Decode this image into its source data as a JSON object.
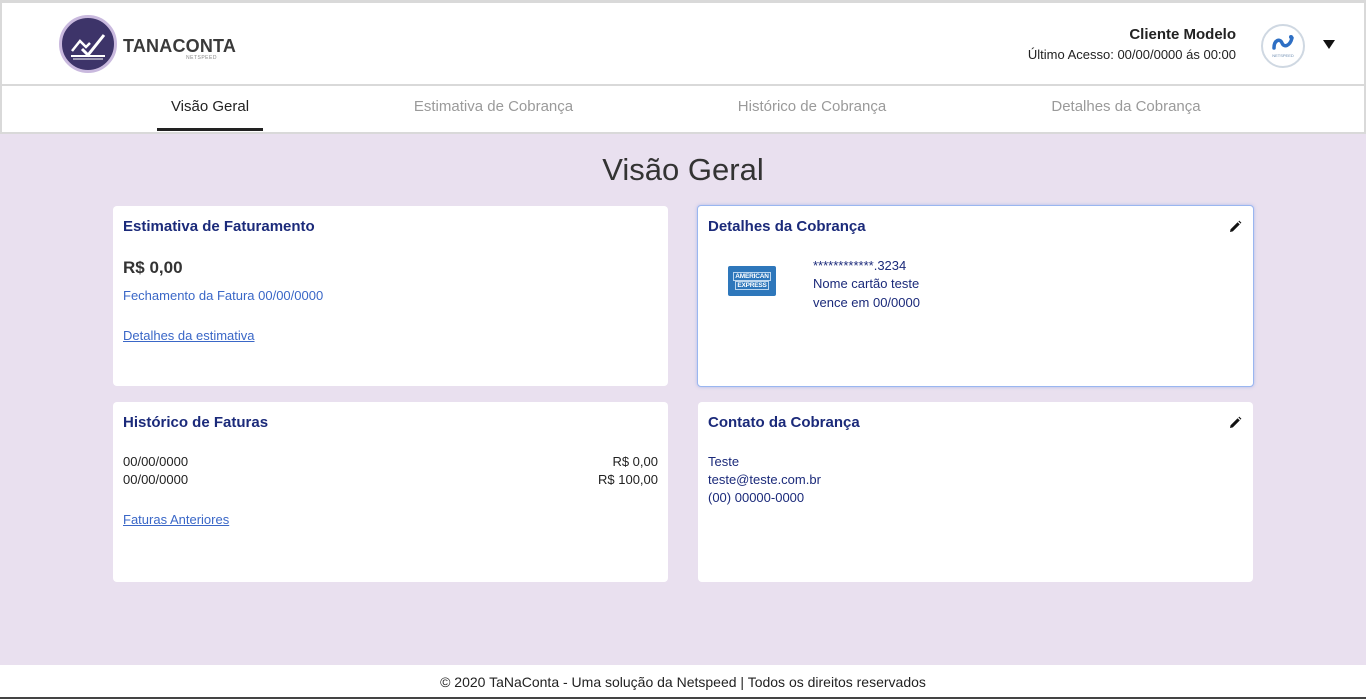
{
  "header": {
    "logo_text": "TANACONTA",
    "logo_sub": "NETSPEED",
    "user_name": "Cliente Modelo",
    "last_access": "Último Acesso: 00/00/0000 ás 00:00",
    "avatar_label": "NETSPEED"
  },
  "nav": {
    "tabs": [
      {
        "label": "Visão Geral",
        "active": true
      },
      {
        "label": "Estimativa de Cobrança",
        "active": false
      },
      {
        "label": "Histórico de Cobrança",
        "active": false
      },
      {
        "label": "Detalhes da Cobrança",
        "active": false
      }
    ]
  },
  "main": {
    "title": "Visão Geral",
    "estimate_card": {
      "title": "Estimativa de Faturamento",
      "amount": "R$ 0,00",
      "closing": "Fechamento da Fatura 00/00/0000",
      "link": "Detalhes da estimativa"
    },
    "billing_details_card": {
      "title": "Detalhes da Cobrança",
      "card_brand_line1": "AMERICAN",
      "card_brand_line2": "EXPRESS",
      "card_number": "************.3234",
      "card_name": "Nome cartão teste",
      "expiry": "vence em  00/0000"
    },
    "invoice_history_card": {
      "title": "Histórico de Faturas",
      "rows": [
        {
          "date": "00/00/0000",
          "value": "R$ 0,00"
        },
        {
          "date": "00/00/0000",
          "value": "R$ 100,00"
        }
      ],
      "link": "Faturas Anteriores"
    },
    "billing_contact_card": {
      "title": "Contato da Cobrança",
      "name": "Teste",
      "email": "teste@teste.com.br",
      "phone": "(00) 00000-0000"
    }
  },
  "footer": {
    "text": "© 2020 TaNaConta - Uma solução da Netspeed | Todos os direitos reservados"
  },
  "colors": {
    "background": "#e9e0ef",
    "card_title": "#1b2a7a",
    "link": "#3a67c7",
    "logo_circle": "#3d3469"
  }
}
